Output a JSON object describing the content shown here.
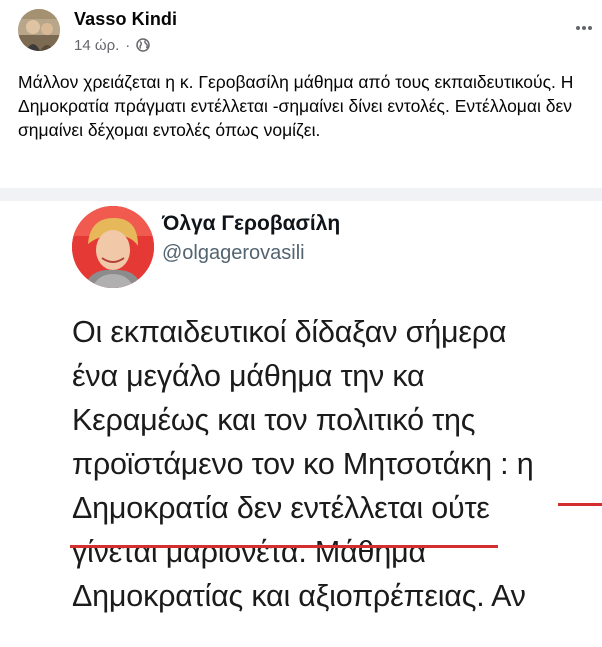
{
  "post": {
    "author": "Vasso Kindi",
    "time": "14 ώρ.",
    "separator": "·",
    "text": "Μάλλον χρειάζεται η κ. Γεροβασίλη μάθημα από τους εκπαιδευτικούς. Η Δημοκρατία πράγματι εντέλλεται -σημαίνει δίνει εντολές. Εντέλλομαι δεν σημαίνει δέχομαι εντολές όπως νομίζει."
  },
  "tweet": {
    "name": "Όλγα Γεροβασίλη",
    "handle": "@olgagerovasili",
    "lines": [
      "Οι εκπαιδευτικοί δίδαξαν σήμερα",
      "ένα μεγάλο μάθημα την κα",
      "Κεραμέως και τον πολιτικό της",
      "προϊστάμενο τον κο Μητσοτάκη : η",
      "Δημοκρατία δεν εντέλλεται ούτε",
      "γίνεται μαριονέτα. Μάθημα",
      "Δημοκρατίας και αξιοπρέπειας. Αν"
    ]
  },
  "colors": {
    "underline": "#d32f2f",
    "meta_gray": "#65676b",
    "divider": "#f0f2f5"
  },
  "icons": {
    "privacy": "globe-icon",
    "menu": "more-options-icon"
  }
}
